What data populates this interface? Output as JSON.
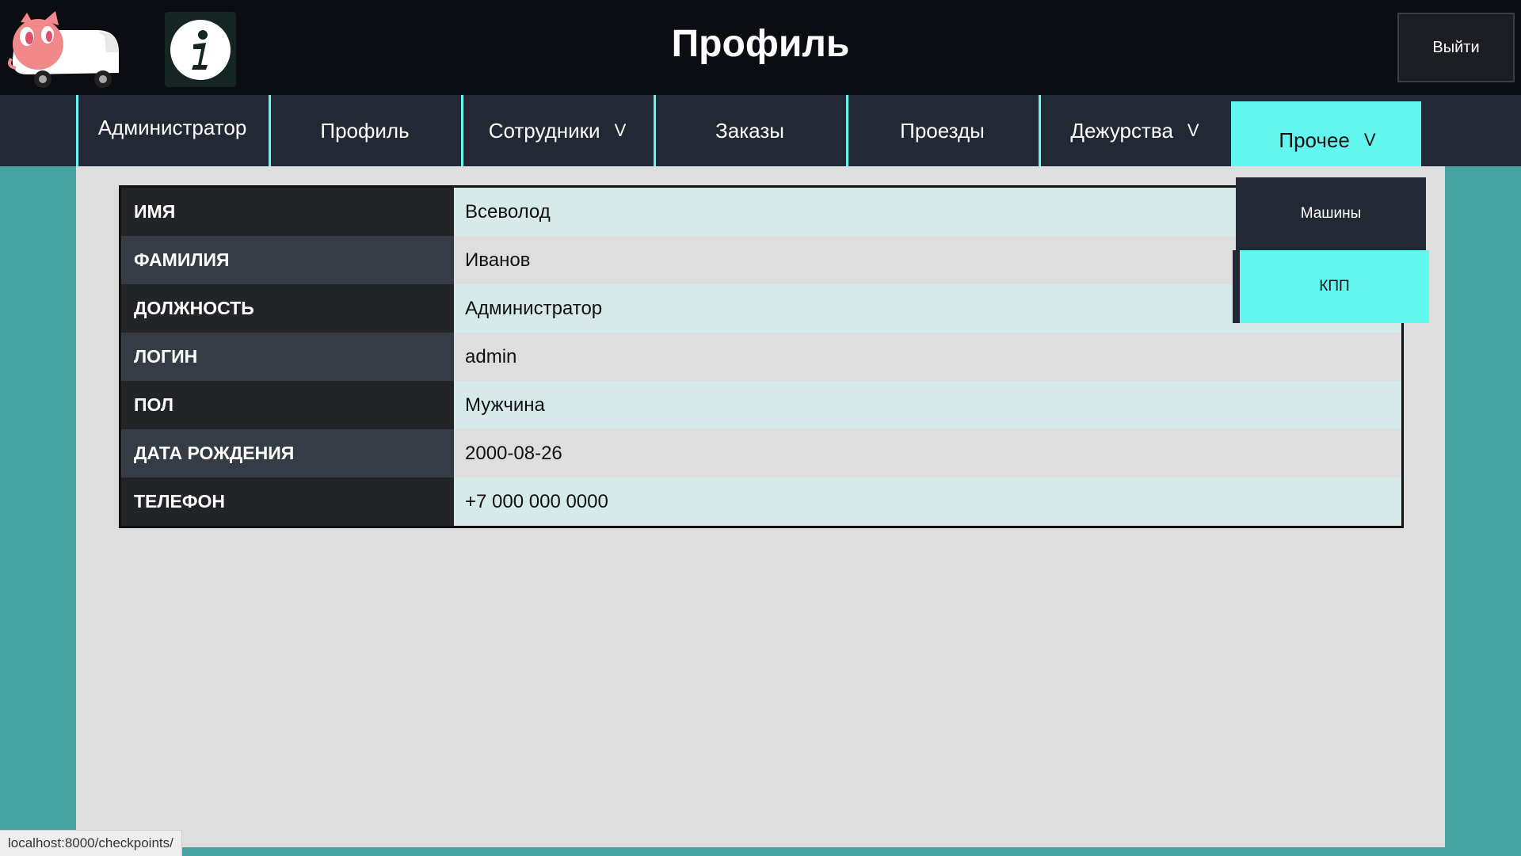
{
  "header": {
    "title": "Профиль",
    "logout_label": "Выйти",
    "logo_icon": "pig-truck-logo",
    "info_icon": "info-icon"
  },
  "nav": {
    "items": [
      {
        "label": "Администратор",
        "has_dropdown": false
      },
      {
        "label": "Профиль",
        "has_dropdown": false
      },
      {
        "label": "Сотрудники",
        "has_dropdown": true
      },
      {
        "label": "Заказы",
        "has_dropdown": false
      },
      {
        "label": "Проезды",
        "has_dropdown": false
      },
      {
        "label": "Дежурства",
        "has_dropdown": true
      },
      {
        "label": "Прочее",
        "has_dropdown": true,
        "active": true
      }
    ],
    "chevron": "V"
  },
  "dropdown": {
    "items": [
      "Машины",
      "КПП"
    ]
  },
  "profile": {
    "rows": [
      {
        "key": "ИМЯ",
        "value": "Всеволод"
      },
      {
        "key": "ФАМИЛИЯ",
        "value": "Иванов"
      },
      {
        "key": "ДОЛЖНОСТЬ",
        "value": "Администратор"
      },
      {
        "key": "ЛОГИН",
        "value": "admin"
      },
      {
        "key": "ПОЛ",
        "value": "Мужчина"
      },
      {
        "key": "ДАТА РОЖДЕНИЯ",
        "value": "2000-08-26"
      },
      {
        "key": "ТЕЛЕФОН",
        "value": "+7 000 000 0000"
      }
    ]
  },
  "status_bar": {
    "url": "localhost:8000/checkpoints/"
  },
  "colors": {
    "accent": "#62f7ef",
    "nav_bg": "#222834",
    "header_bg": "#0b0d12",
    "page_bg": "#46a3a1"
  }
}
